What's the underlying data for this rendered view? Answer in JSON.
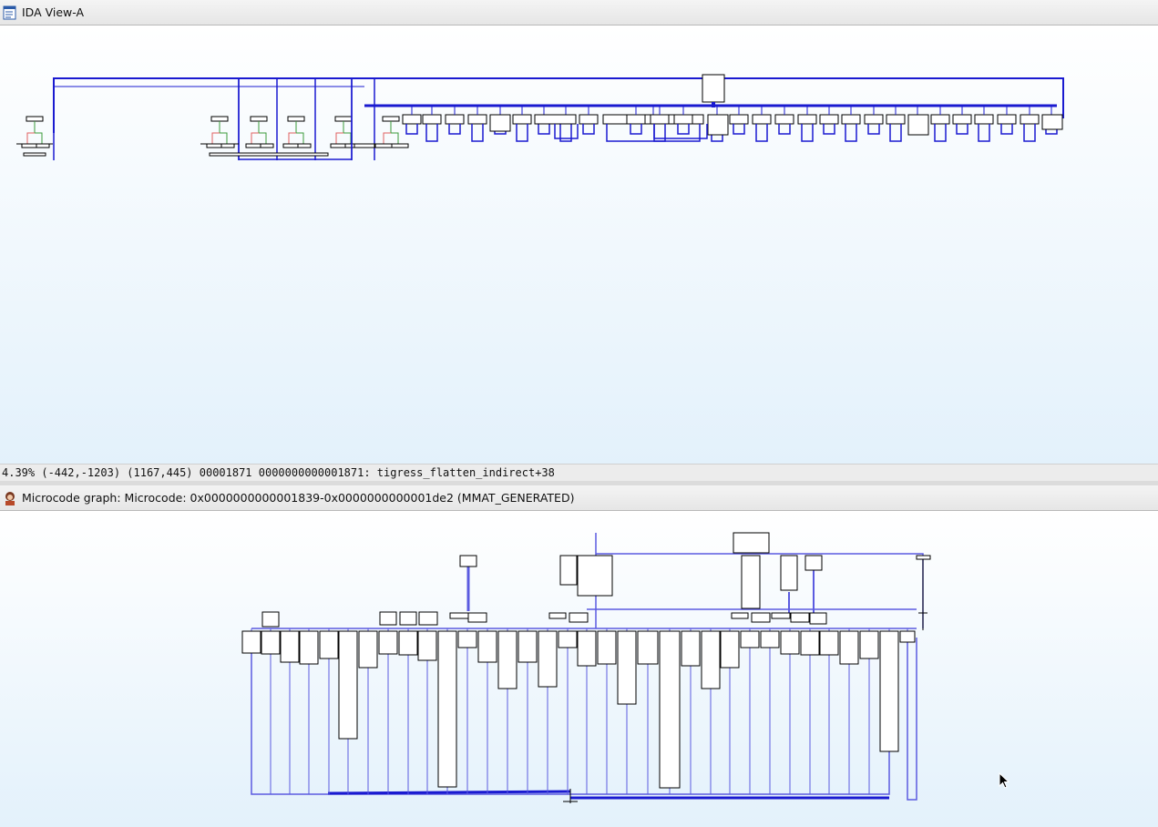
{
  "top_panel": {
    "title": "IDA View-A",
    "icon": "ida-view-icon",
    "status": "4.39% (-442,-1203) (1167,445) 00001871 0000000000001871: tigress_flatten_indirect+38"
  },
  "bottom_panel": {
    "title": "Microcode graph: Microcode: 0x0000000000001839-0x0000000000001de2 (MMAT_GENERATED)",
    "icon": "microcode-avatar-icon"
  },
  "colors": {
    "edge_blue": "#1a1ad0",
    "edge_light_blue": "#5b5be0",
    "edge_red": "#e06060",
    "edge_green": "#3a9a3a",
    "graph_bg_top": "#ffffff",
    "graph_bg_bottom": "#e3f1fb"
  }
}
